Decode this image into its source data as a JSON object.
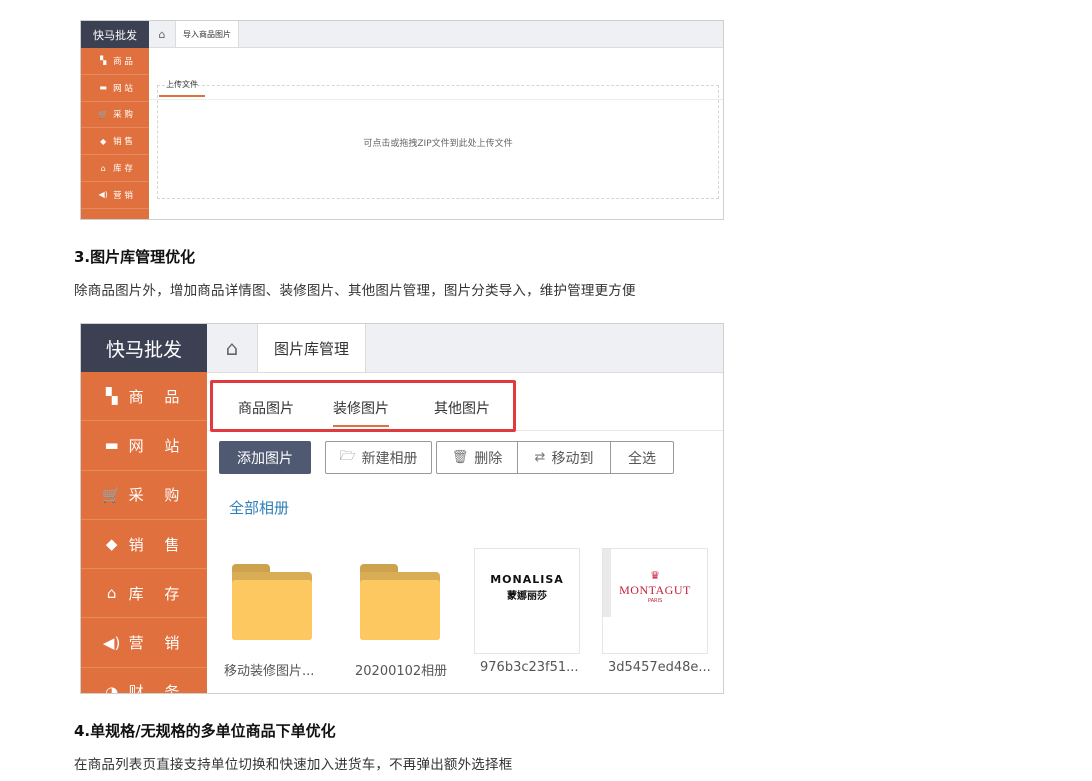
{
  "app": {
    "brand": "快马批发"
  },
  "sidebar": {
    "items": [
      {
        "icon": "grid-icon",
        "glyph": "▚",
        "label": "商 品"
      },
      {
        "icon": "monitor-icon",
        "glyph": "▬",
        "label": "网 站"
      },
      {
        "icon": "cart-icon",
        "glyph": "🛒",
        "label": "采 购"
      },
      {
        "icon": "tag-icon",
        "glyph": "◆",
        "label": "销 售"
      },
      {
        "icon": "warehouse-icon",
        "glyph": "⌂",
        "label": "库 存"
      },
      {
        "icon": "speaker-icon",
        "glyph": "◀)",
        "label": "营 销"
      },
      {
        "icon": "pie-icon",
        "glyph": "◔",
        "label": "财 务"
      }
    ]
  },
  "shot1": {
    "top_tab": "导入商品图片",
    "subtab": "上传文件",
    "dropzone_text": "可点击或拖拽ZIP文件到此处上传文件"
  },
  "section3": {
    "heading": "3.图片库管理优化",
    "text": "除商品图片外，增加商品详情图、装修图片、其他图片管理，图片分类导入，维护管理更方便"
  },
  "shot2": {
    "top_tab": "图片库管理",
    "categories": [
      "商品图片",
      "装修图片",
      "其他图片"
    ],
    "active_category": "装修图片",
    "toolbar": {
      "add": "添加图片",
      "new_album": "新建相册",
      "delete": "删除",
      "move_to": "移动到",
      "select_all": "全选"
    },
    "all_albums": "全部相册",
    "items": [
      {
        "type": "folder",
        "caption": "移动装修图片..."
      },
      {
        "type": "folder",
        "caption": "20200102相册"
      },
      {
        "type": "image",
        "logo": "MONALISA",
        "logo_sub": "蒙娜丽莎",
        "caption": "976b3c23f51..."
      },
      {
        "type": "image",
        "logo": "MONTAGUT",
        "logo_sub": "PARIS",
        "caption": "3d5457ed48e..."
      }
    ]
  },
  "section4": {
    "heading": "4.单规格/无规格的多单位商品下单优化",
    "text": "在商品列表页直接支持单位切换和快速加入进货车，不再弹出额外选择框"
  },
  "colors": {
    "sidebar": "#e0703d",
    "brand_bg": "#3b4152",
    "highlight_box": "#e0393e",
    "primary_button": "#4f5a72",
    "link": "#2e7fb8"
  }
}
